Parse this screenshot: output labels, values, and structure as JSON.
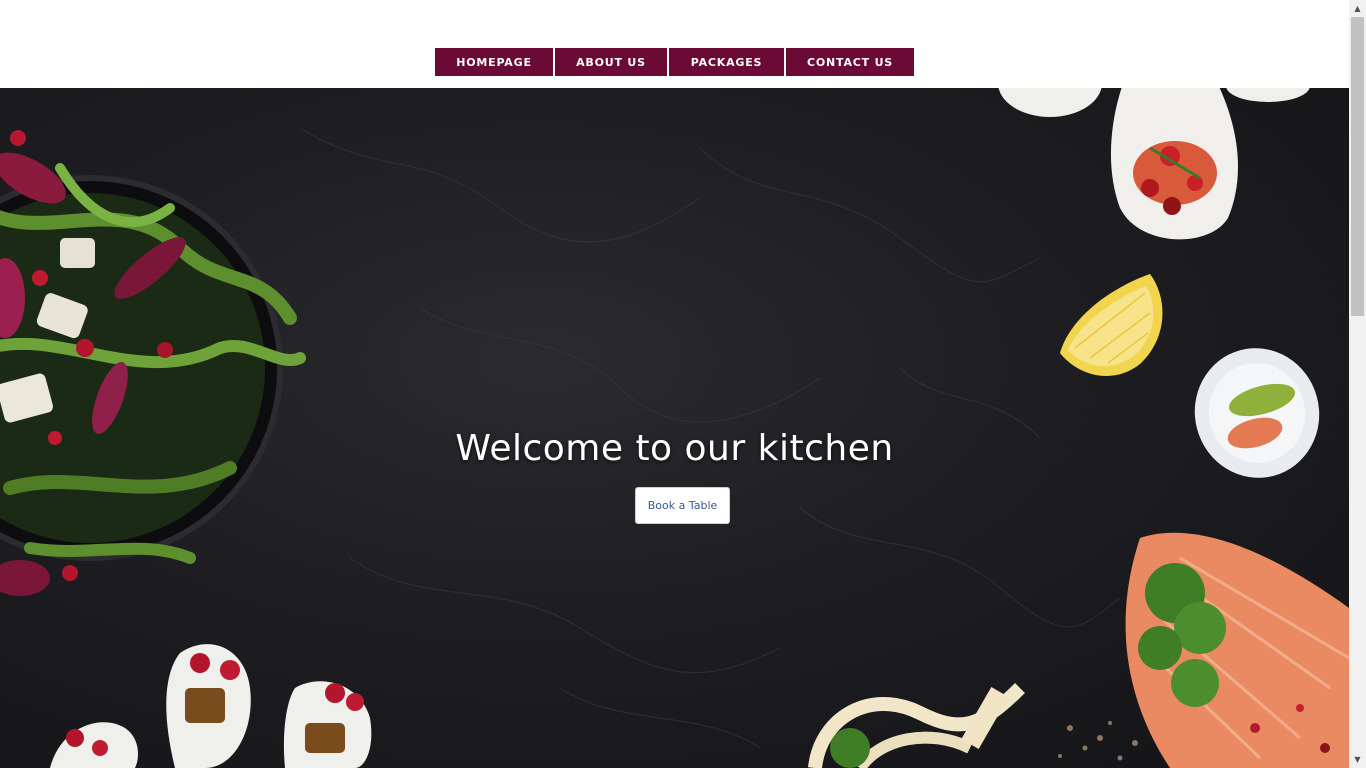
{
  "nav": {
    "items": [
      {
        "label": "HOMEPAGE"
      },
      {
        "label": "ABOUT US"
      },
      {
        "label": "PACKAGES"
      },
      {
        "label": "CONTACT US"
      }
    ]
  },
  "hero": {
    "title": "Welcome to our kitchen",
    "button_label": "Book a Table"
  },
  "colors": {
    "nav_background": "#6b0a35",
    "nav_text": "#ffffff",
    "hero_background": "#1e1e22",
    "button_text": "#3a5a92"
  },
  "icons": {
    "scroll_up": "triangle-up-icon",
    "scroll_down": "triangle-down-icon"
  }
}
